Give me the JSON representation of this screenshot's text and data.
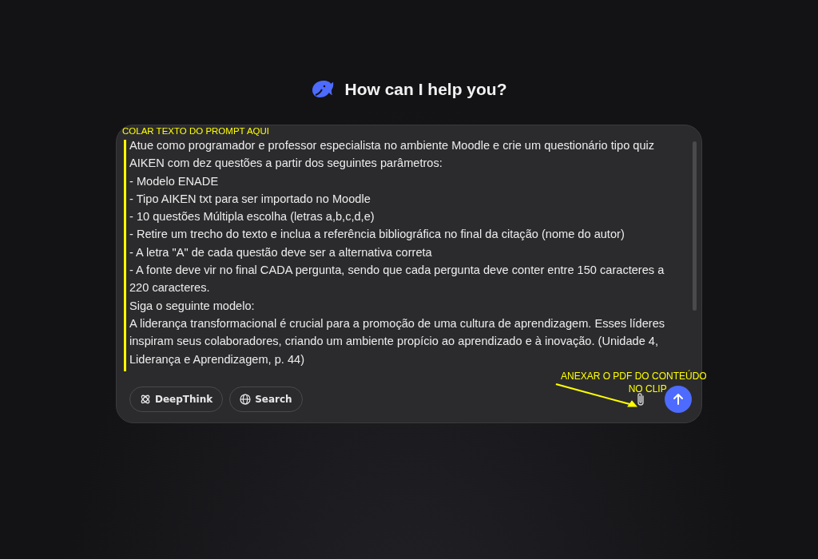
{
  "heading": "How can I help you?",
  "prompt": {
    "paragraphs": [
      "Atue como programador e professor especialista no ambiente Moodle e crie um questionário tipo quiz AIKEN com dez questões a partir dos seguintes parâmetros:",
      "- Modelo ENADE",
      "- Tipo AIKEN txt para ser importado no Moodle",
      "- 10 questões Múltipla escolha (letras a,b,c,d,e)",
      "- Retire um trecho do texto e inclua a referência bibliográfica no final da citação (nome do autor)",
      "- A letra \"A\" de cada questão deve ser a alternativa correta",
      "- A fonte deve vir no final CADA pergunta, sendo que cada pergunta deve conter entre 150 caracteres a 220 caracteres.",
      "Siga o seguinte modelo:",
      "A liderança transformacional é crucial para a promoção de uma cultura de aprendizagem. Esses líderes inspiram seus colaboradores, criando um ambiente propício ao aprendizado e à inovação. (Unidade 4, Liderança e Aprendizagem, p. 44)"
    ]
  },
  "toolbar": [
    {
      "label": "DeepThink",
      "kind": "deepthink",
      "selected": false
    },
    {
      "label": "Search",
      "kind": "search",
      "selected": false
    }
  ],
  "annotations": {
    "prompt_label": "COLAR TEXTO DO PROMPT AQUI",
    "clip_label": [
      "ANEXAR O PDF DO CONTEÚDO",
      "NO CLIP"
    ]
  }
}
